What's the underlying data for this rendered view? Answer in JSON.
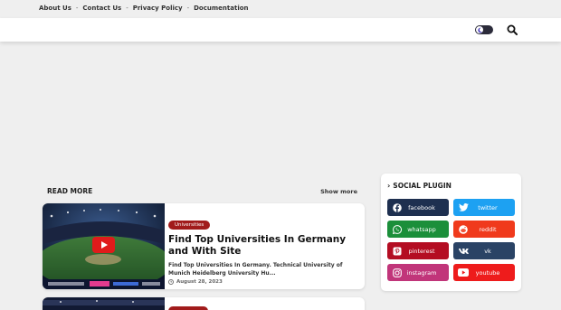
{
  "top_nav": {
    "links": [
      "About Us",
      "Contact Us",
      "Privacy Policy",
      "Documentation"
    ],
    "separator": "-"
  },
  "header": {
    "theme_toggle_icon": "moon-icon",
    "search_icon": "search-icon"
  },
  "main": {
    "section_title": "READ MORE",
    "show_more_label": "Show more",
    "posts": [
      {
        "category": "Universities",
        "title": "Find Top Universities In Germany and With Site",
        "snippet": "Find Top Universities In Germany. Technical University of Munich Heidelberg University Hu...",
        "date": "August 28, 2023",
        "thumbnail_icon": "video-play-icon"
      }
    ]
  },
  "sidebar": {
    "title": "SOCIAL PLUGIN",
    "social_buttons": [
      {
        "label": "facebook",
        "icon": "facebook-icon",
        "color": "#1e3050"
      },
      {
        "label": "twitter",
        "icon": "twitter-icon",
        "color": "#1da1f2"
      },
      {
        "label": "whatsapp",
        "icon": "whatsapp-icon",
        "color": "#1b8f3a"
      },
      {
        "label": "reddit",
        "icon": "reddit-icon",
        "color": "#f03a1c"
      },
      {
        "label": "pinterest",
        "icon": "pinterest-icon",
        "color": "#b40d22"
      },
      {
        "label": "vk",
        "icon": "vk-icon",
        "color": "#2a4365"
      },
      {
        "label": "instagram",
        "icon": "instagram-icon",
        "color": "#c1357a"
      },
      {
        "label": "youtube",
        "icon": "youtube-icon",
        "color": "#ee1c1c"
      }
    ]
  },
  "colors": {
    "page_bg": "#efefef",
    "accent": "#a11b1b"
  }
}
